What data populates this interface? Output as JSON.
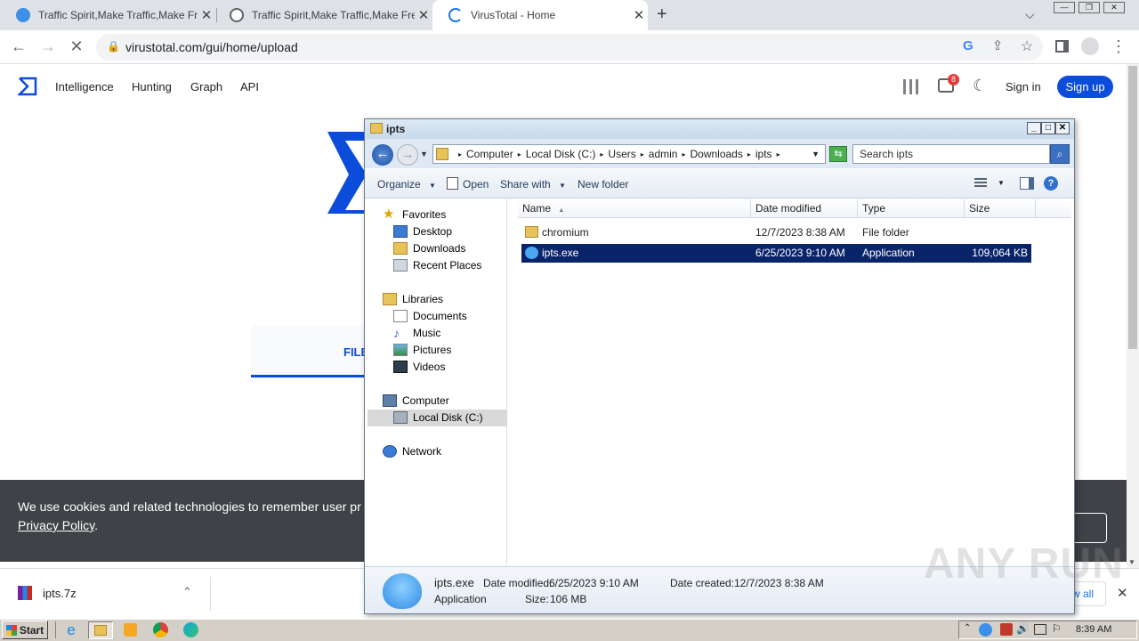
{
  "browser": {
    "tabs": [
      {
        "title": "Traffic Spirit,Make Traffic,Make Free",
        "icon": "traffic-spirit-icon"
      },
      {
        "title": "Traffic Spirit,Make Traffic,Make Free",
        "icon": "globe-icon"
      },
      {
        "title": "VirusTotal - Home",
        "icon": "loading-spinner-icon"
      }
    ],
    "url": "virustotal.com/gui/home/upload"
  },
  "vt": {
    "nav": [
      "Intelligence",
      "Hunting",
      "Graph",
      "API"
    ],
    "notification_count": "8",
    "signin": "Sign in",
    "signup": "Sign up",
    "file_tab": "FILE",
    "cookie_text": "We use cookies and related technologies to remember user pr",
    "privacy_link": "Privacy Policy",
    "privacy_suffix": "."
  },
  "downloads": {
    "file": "ipts.7z",
    "show_all": "w all"
  },
  "explorer": {
    "title": "ipts",
    "breadcrumb": [
      "Computer",
      "Local Disk (C:)",
      "Users",
      "admin",
      "Downloads",
      "ipts"
    ],
    "search_placeholder": "Search ipts",
    "commands": [
      "Organize",
      "Open",
      "Share with",
      "New folder"
    ],
    "columns": [
      "Name",
      "Date modified",
      "Type",
      "Size"
    ],
    "nav": {
      "favorites": "Favorites",
      "fav_items": [
        "Desktop",
        "Downloads",
        "Recent Places"
      ],
      "libraries": "Libraries",
      "lib_items": [
        "Documents",
        "Music",
        "Pictures",
        "Videos"
      ],
      "computer": "Computer",
      "disk": "Local Disk (C:)",
      "network": "Network"
    },
    "files": [
      {
        "name": "chromium",
        "date": "12/7/2023 8:38 AM",
        "type": "File folder",
        "size": ""
      },
      {
        "name": "ipts.exe",
        "date": "6/25/2023 9:10 AM",
        "type": "Application",
        "size": "109,064 KB"
      }
    ],
    "details": {
      "name": "ipts.exe",
      "type": "Application",
      "modified_label": "Date modified:",
      "modified": "6/25/2023 9:10 AM",
      "created_label": "Date created:",
      "created": "12/7/2023 8:38 AM",
      "size_label": "Size:",
      "size": "106 MB"
    }
  },
  "taskbar": {
    "start": "Start",
    "clock": "8:39 AM"
  },
  "watermark": "ANY RUN"
}
